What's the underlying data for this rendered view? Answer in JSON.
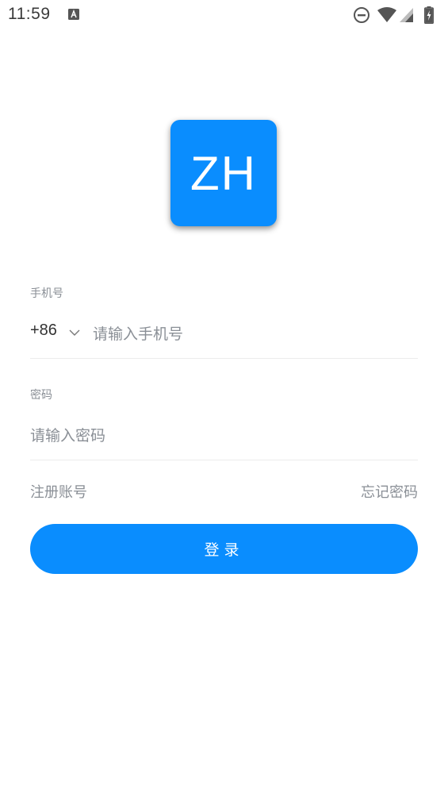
{
  "status_bar": {
    "time": "11:59",
    "icons": [
      "keyboard-a-icon",
      "do-not-disturb-icon",
      "wifi-icon",
      "cell-signal-icon",
      "battery-charging-icon"
    ]
  },
  "logo": {
    "text": "ZH",
    "color": "#0a8dfe"
  },
  "phone": {
    "label": "手机号",
    "country_code": "+86",
    "placeholder": "请输入手机号"
  },
  "password": {
    "label": "密码",
    "placeholder": "请输入密码"
  },
  "links": {
    "register": "注册账号",
    "forgot": "忘记密码"
  },
  "login_button": {
    "label": "登录",
    "color": "#0a8dfe"
  }
}
